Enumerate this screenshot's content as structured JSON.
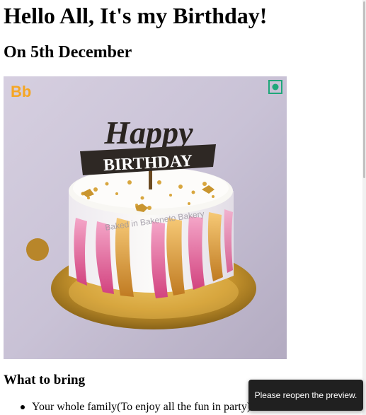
{
  "heading": "Hello All, It's my Birthday!",
  "subheading": "On 5th December",
  "image": {
    "logo_text": "Bb",
    "topper_script": "Happy",
    "topper_banner": "BIRTHDAY",
    "watermark": "Baked in Bakeneto Bakery"
  },
  "bring_section": {
    "title": "What to bring",
    "items": [
      "Your whole family(To enjoy all the fun in party)"
    ]
  },
  "toast": {
    "message": "Please reopen the preview."
  },
  "colors": {
    "page_background": "#ffffff",
    "text": "#000000",
    "toast_background": "#202020",
    "toast_text": "#ffffff",
    "logo_orange": "#f5a623",
    "badge_green": "#1fa77a"
  }
}
